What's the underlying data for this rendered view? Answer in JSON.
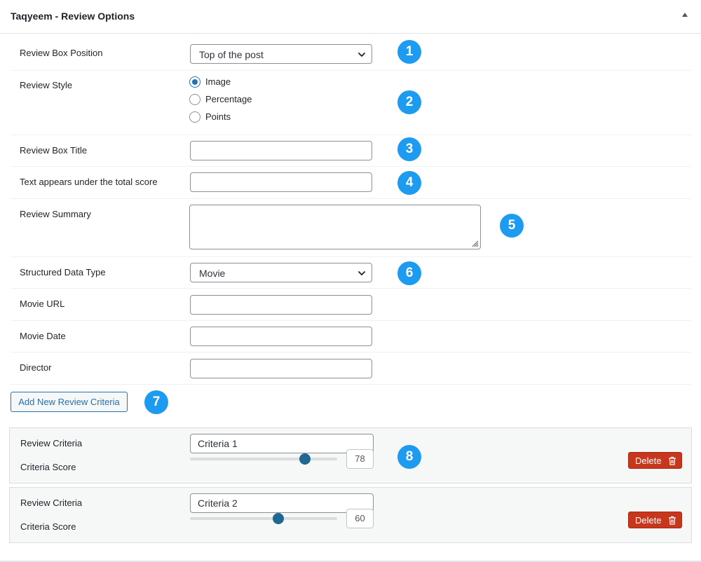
{
  "panel": {
    "title": "Taqyeem - Review Options"
  },
  "fields": {
    "box_position": {
      "label": "Review Box Position",
      "value": "Top of the post"
    },
    "review_style": {
      "label": "Review Style",
      "options": [
        "Image",
        "Percentage",
        "Points"
      ],
      "selected": "Image"
    },
    "box_title": {
      "label": "Review Box Title",
      "value": ""
    },
    "total_score_text": {
      "label": "Text appears under the total score",
      "value": ""
    },
    "summary": {
      "label": "Review Summary",
      "value": ""
    },
    "structured_type": {
      "label": "Structured Data Type",
      "value": "Movie"
    },
    "movie_url": {
      "label": "Movie URL",
      "value": ""
    },
    "movie_date": {
      "label": "Movie Date",
      "value": ""
    },
    "director": {
      "label": "Director",
      "value": ""
    }
  },
  "add_button": {
    "label": "Add New Review Criteria"
  },
  "badges": [
    "1",
    "2",
    "3",
    "4",
    "5",
    "6",
    "7",
    "8"
  ],
  "criteria": [
    {
      "criteria_label": "Review Criteria",
      "name": "Criteria 1",
      "score_label": "Criteria Score",
      "score": "78",
      "delete_label": "Delete"
    },
    {
      "criteria_label": "Review Criteria",
      "name": "Criteria 2",
      "score_label": "Criteria Score",
      "score": "60",
      "delete_label": "Delete"
    }
  ],
  "colors": {
    "accent": "#2271b1",
    "badge": "#1d9bf0",
    "delete": "#c7371d",
    "slider_thumb": "#1e6891"
  },
  "icons": {
    "collapse": "triangle-up-icon",
    "select_arrow": "chevron-down-icon",
    "delete": "trash-icon"
  }
}
